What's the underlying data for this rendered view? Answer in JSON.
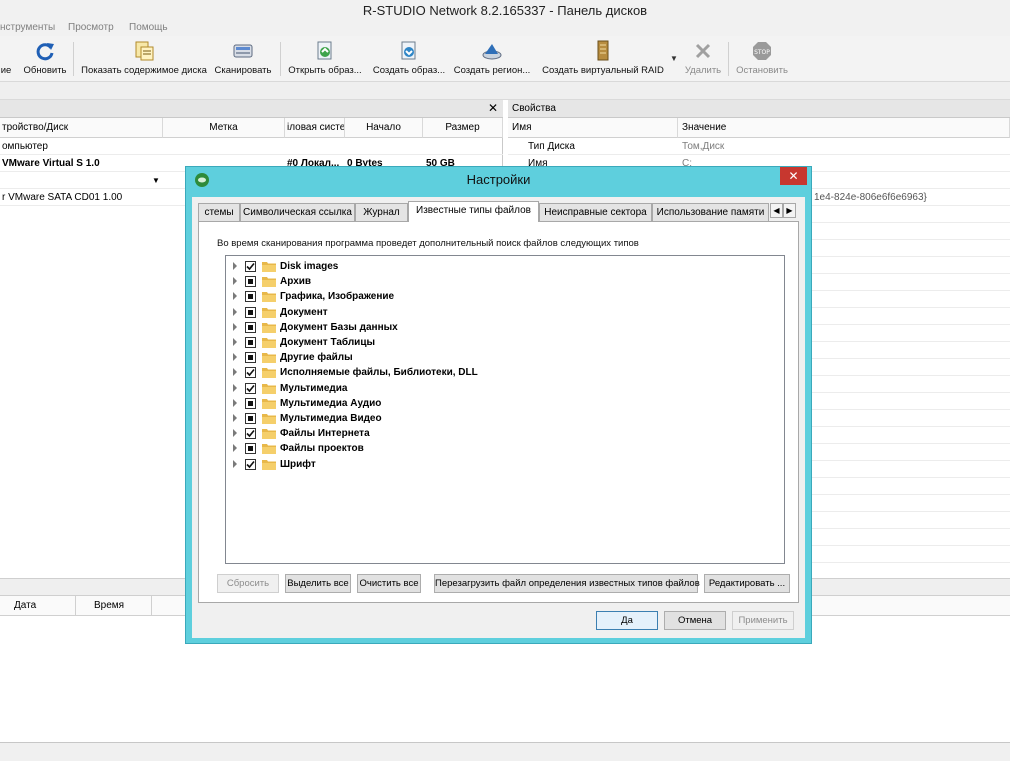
{
  "window": {
    "title": "R-STUDIO Network 8.2.165337 - Панель дисков"
  },
  "menu": {
    "items": [
      "нструменты",
      "Просмотр",
      "Помощь"
    ]
  },
  "toolbar": {
    "items": [
      {
        "label": "ие",
        "icon": "partial-icon",
        "enabled": true
      },
      {
        "label": "Обновить",
        "icon": "refresh-icon",
        "enabled": true
      },
      {
        "label": "Показать содержимое диска",
        "icon": "show-content-icon",
        "enabled": true
      },
      {
        "label": "Сканировать",
        "icon": "scan-icon",
        "enabled": true
      },
      {
        "label": "Открыть образ...",
        "icon": "open-image-icon",
        "enabled": true
      },
      {
        "label": "Создать образ...",
        "icon": "create-image-icon",
        "enabled": true
      },
      {
        "label": "Создать регион...",
        "icon": "create-region-icon",
        "enabled": true
      },
      {
        "label": "Создать виртуальный RAID",
        "icon": "virtual-raid-icon",
        "enabled": true
      },
      {
        "label": "Удалить",
        "icon": "delete-icon",
        "enabled": false
      },
      {
        "label": "Остановить",
        "icon": "stop-icon",
        "enabled": false
      }
    ]
  },
  "devices": {
    "columns": [
      "тройство/Диск",
      "Метка",
      "іловая систе",
      "Начало",
      "Размер"
    ],
    "rows": [
      {
        "name": "омпьютер",
        "label": "",
        "fs": "",
        "start": "",
        "size": ""
      },
      {
        "name": "VMware Virtual S 1.0",
        "label": "",
        "fs": "#0 Локал...",
        "start": "0 Bytes",
        "size": "50 GB"
      },
      {
        "name": "",
        "label": "",
        "fs": "",
        "start": "",
        "size": ""
      },
      {
        "name": "r VMware SATA CD01 1.00",
        "label": "",
        "fs": "",
        "start": "",
        "size": ""
      }
    ]
  },
  "properties": {
    "title": "Свойства",
    "columns": [
      "Имя",
      "Значение"
    ],
    "rows": [
      {
        "name": "Тип Диска",
        "value": "Том,Диск"
      },
      {
        "name": "Имя",
        "value": "C:"
      }
    ],
    "overflow_value": "1e4-824e-806e6f6e6963}"
  },
  "log": {
    "columns": [
      "Дата",
      "Время"
    ]
  },
  "dialog": {
    "title": "Настройки",
    "tabs": [
      "стемы",
      "Символическая ссылка",
      "Журнал",
      "Известные типы файлов",
      "Неисправные сектора",
      "Использование памяти"
    ],
    "active_tab": "Известные типы файлов",
    "description": "Во время сканирования программа проведет дополнительный поиск файлов следующих типов",
    "filetypes": [
      {
        "label": "Disk images",
        "state": "checked"
      },
      {
        "label": "Архив",
        "state": "partial"
      },
      {
        "label": "Графика, Изображение",
        "state": "partial"
      },
      {
        "label": "Документ",
        "state": "partial"
      },
      {
        "label": "Документ Базы данных",
        "state": "partial"
      },
      {
        "label": "Документ Таблицы",
        "state": "partial"
      },
      {
        "label": "Другие файлы",
        "state": "partial"
      },
      {
        "label": "Исполняемые файлы, Библиотеки, DLL",
        "state": "checked"
      },
      {
        "label": "Мультимедиа",
        "state": "checked"
      },
      {
        "label": "Мультимедиа Аудио",
        "state": "partial"
      },
      {
        "label": "Мультимедиа Видео",
        "state": "partial"
      },
      {
        "label": "Файлы Интернета",
        "state": "checked"
      },
      {
        "label": "Файлы проектов",
        "state": "partial"
      },
      {
        "label": "Шрифт",
        "state": "checked"
      }
    ],
    "buttons": {
      "reset": "Сбросить",
      "select_all": "Выделить все",
      "clear_all": "Очистить все",
      "reload": "Перезагрузить файл определения известных типов файлов",
      "edit": "Редактировать ..."
    },
    "footer": {
      "ok": "Да",
      "cancel": "Отмена",
      "apply": "Применить"
    },
    "colors": {
      "frame": "#5ecfdd",
      "close": "#c7372f"
    }
  }
}
